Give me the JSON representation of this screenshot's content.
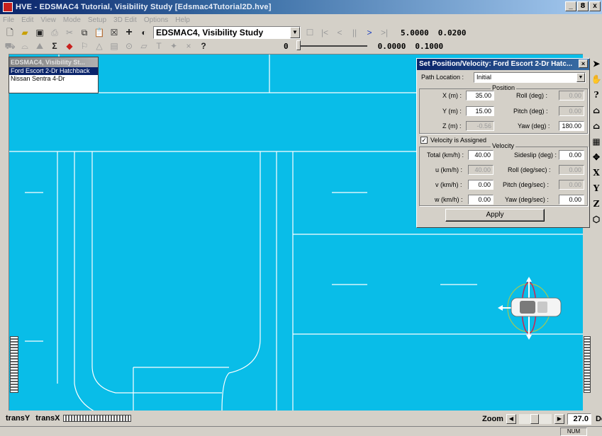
{
  "window": {
    "title": "HVE - EDSMAC4 Tutorial, Visibility Study [Edsmac4Tutorial2D.hve]",
    "buttons": [
      "_",
      "8",
      "x"
    ]
  },
  "menu": [
    "File",
    "Edit",
    "View",
    "Mode",
    "Setup",
    "3D Edit",
    "Options",
    "Help"
  ],
  "toolbar": {
    "event_select": "EDSMAC4, Visibility Study",
    "time_top": "5.0000",
    "dt_top": "0.0200",
    "frame": "0",
    "time_bottom": "0.0000",
    "dt_bottom": "0.1000"
  },
  "vehicle_list": {
    "title": "EDSMAC4, Visibility St...",
    "items": [
      "Ford Escort 2-Dr Hatchback",
      "Nissan Sentra 4-Dr"
    ],
    "selected_index": 0
  },
  "dialog": {
    "title": "Set Position/Velocity: Ford Escort 2-Dr Hatc...",
    "path_location_label": "Path Location :",
    "path_location_value": "Initial",
    "position_group": "Position",
    "x_label": "X (m) :",
    "x_value": "35.00",
    "y_label": "Y (m) :",
    "y_value": "15.00",
    "z_label": "Z (m) :",
    "z_value": "-0.56",
    "roll_label": "Roll (deg) :",
    "roll_value": "0.00",
    "pitch_label": "Pitch (deg) :",
    "pitch_value": "0.00",
    "yaw_label": "Yaw (deg) :",
    "yaw_value": "180.00",
    "velocity_assigned_label": "Velocity is Assigned",
    "velocity_group": "Velocity",
    "total_label": "Total (km/h) :",
    "total_value": "40.00",
    "u_label": "u (km/h) :",
    "u_value": "40.00",
    "v_label": "v (km/h) :",
    "v_value": "0.00",
    "w_label": "w (km/h) :",
    "w_value": "0.00",
    "sideslip_label": "Sideslip (deg) :",
    "sideslip_value": "0.00",
    "roll_rate_label": "Roll (deg/sec) :",
    "roll_rate_value": "0.00",
    "pitch_rate_label": "Pitch (deg/sec) :",
    "pitch_rate_value": "0.00",
    "yaw_rate_label": "Yaw (deg/sec) :",
    "yaw_rate_value": "0.00",
    "apply_label": "Apply"
  },
  "right_tools": [
    "arrow",
    "hand",
    "?",
    "house",
    "house",
    "grid",
    "target",
    "X",
    "Y",
    "Z",
    "cube"
  ],
  "bottom": {
    "trans_y": "transY",
    "trans_x": "transX",
    "zoom_label": "Zoom",
    "zoom_value": "27.0",
    "dolly_label": "Dolly"
  },
  "status": {
    "num": "NUM"
  },
  "colors": {
    "viewport": "#09bde8",
    "road_line": "#ffffff",
    "title_active": "#0a246a"
  }
}
